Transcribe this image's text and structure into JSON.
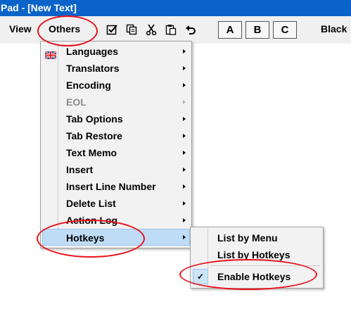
{
  "window": {
    "title": "Pad - [New Text]"
  },
  "menubar": {
    "view": "View",
    "others": "Others",
    "black": "Black"
  },
  "toolbar": {
    "icons": [
      "check-icon",
      "copy-icon",
      "cut-icon",
      "paste-icon",
      "undo-icon"
    ],
    "buttons": [
      "A",
      "B",
      "C"
    ]
  },
  "others_menu": {
    "items": [
      {
        "label": "Languages",
        "icon": "uk-flag-icon",
        "submenu": true
      },
      {
        "label": "Translators",
        "submenu": true
      },
      {
        "label": "Encoding",
        "submenu": true
      },
      {
        "label": "EOL",
        "submenu": true,
        "disabled": true
      },
      {
        "label": "Tab Options",
        "submenu": true
      },
      {
        "label": "Tab Restore",
        "submenu": true
      },
      {
        "label": "Text Memo",
        "submenu": true
      },
      {
        "label": "Insert",
        "submenu": true
      },
      {
        "label": "Insert Line Number",
        "submenu": true
      },
      {
        "label": "Delete List",
        "submenu": true
      },
      {
        "label": "Action Log",
        "submenu": true
      },
      {
        "label": "Hotkeys",
        "submenu": true,
        "highlighted": true
      }
    ]
  },
  "hotkeys_submenu": {
    "items": [
      {
        "label": "List by Menu"
      },
      {
        "label": "List by Hotkeys"
      },
      {
        "label": "Enable Hotkeys",
        "checked": true
      }
    ]
  },
  "colors": {
    "titlebar": "#0a63c8",
    "highlight": "#bfdcf7",
    "annotation_ring": "#e8121b"
  }
}
